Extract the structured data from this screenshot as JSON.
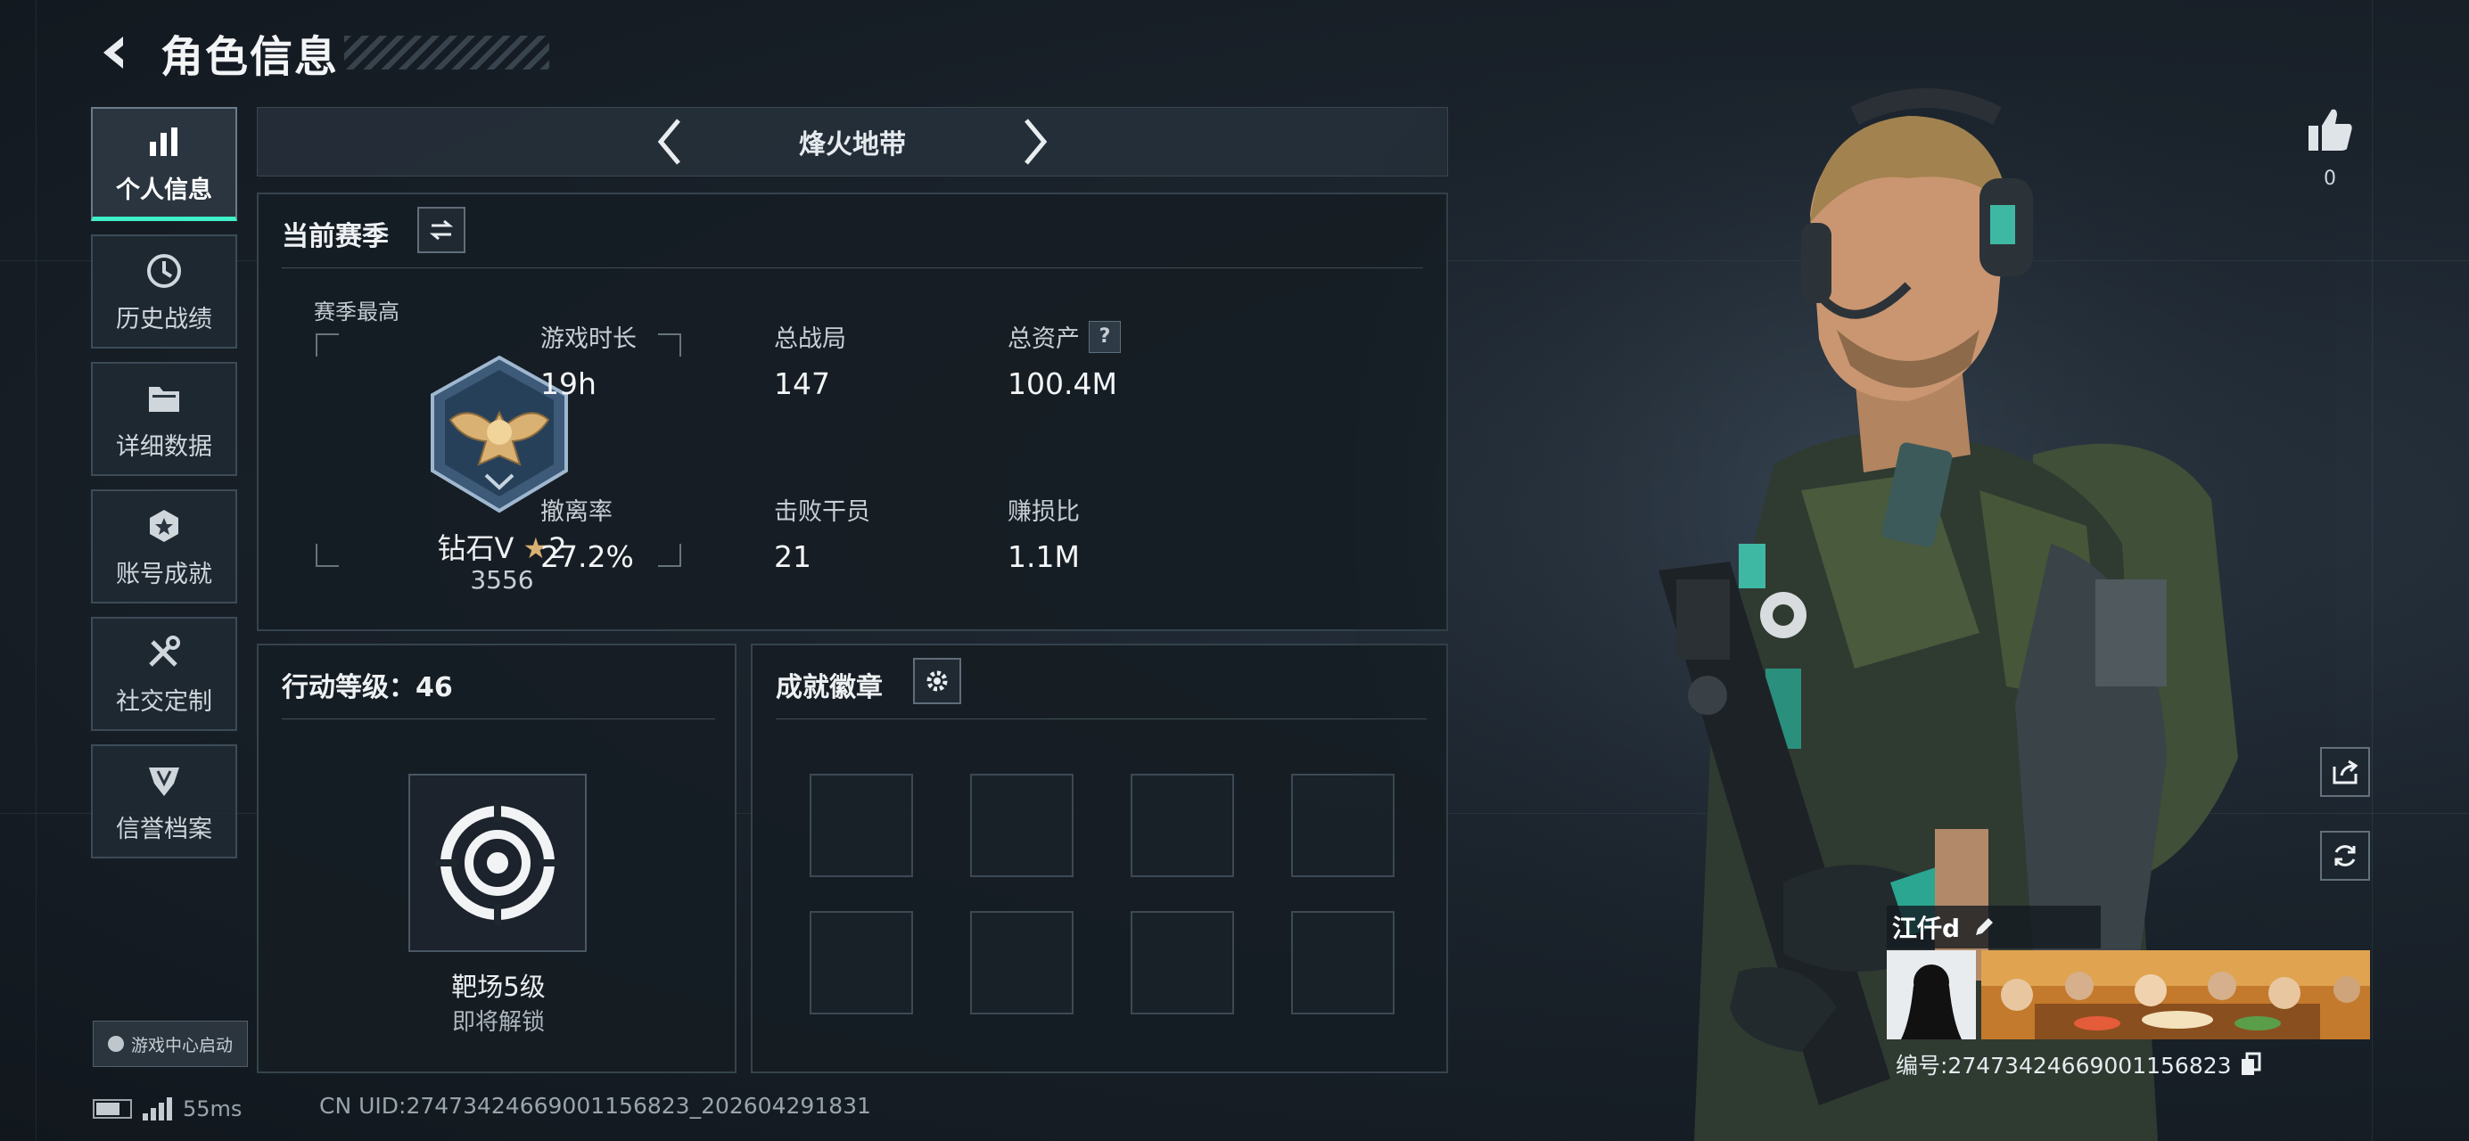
{
  "header": {
    "title": "角色信息"
  },
  "sidebar": {
    "items": [
      {
        "label": "个人信息",
        "icon": "bar-chart-icon",
        "active": true
      },
      {
        "label": "历史战绩",
        "icon": "history-icon"
      },
      {
        "label": "详细数据",
        "icon": "folder-icon"
      },
      {
        "label": "账号成就",
        "icon": "medal-icon"
      },
      {
        "label": "社交定制",
        "icon": "tools-icon"
      },
      {
        "label": "信誉档案",
        "icon": "shield-icon"
      }
    ],
    "game_center_label": "游戏中心启动"
  },
  "mode_selector": {
    "current": "烽火地带"
  },
  "season_panel": {
    "title": "当前赛季",
    "best_label": "赛季最高",
    "rank_name": "钻石V",
    "rank_stars": "2",
    "rank_score": "3556",
    "stats": [
      {
        "label": "游戏时长",
        "value": "19h"
      },
      {
        "label": "总战局",
        "value": "147"
      },
      {
        "label": "总资产",
        "value": "100.4M",
        "help": "?"
      },
      {
        "label": "撤离率",
        "value": "27.2%"
      },
      {
        "label": "击败干员",
        "value": "21"
      },
      {
        "label": "赚损比",
        "value": "1.1M"
      }
    ]
  },
  "level_panel": {
    "title": "行动等级：46",
    "target_name": "靶场5级",
    "target_status": "即将解锁"
  },
  "achievement_panel": {
    "title": "成就徽章",
    "slots": 8
  },
  "likes": {
    "count": "0"
  },
  "player": {
    "name": "江仟d",
    "id_text": "编号:2747342466900115682​3"
  },
  "status_bar": {
    "ping": "55ms",
    "uid": "CN UID:2747342466900115682​3_202604291831"
  },
  "colors": {
    "accent": "#3ff0c8",
    "panel_bg": "#161d24",
    "text": "#e6ebef"
  }
}
